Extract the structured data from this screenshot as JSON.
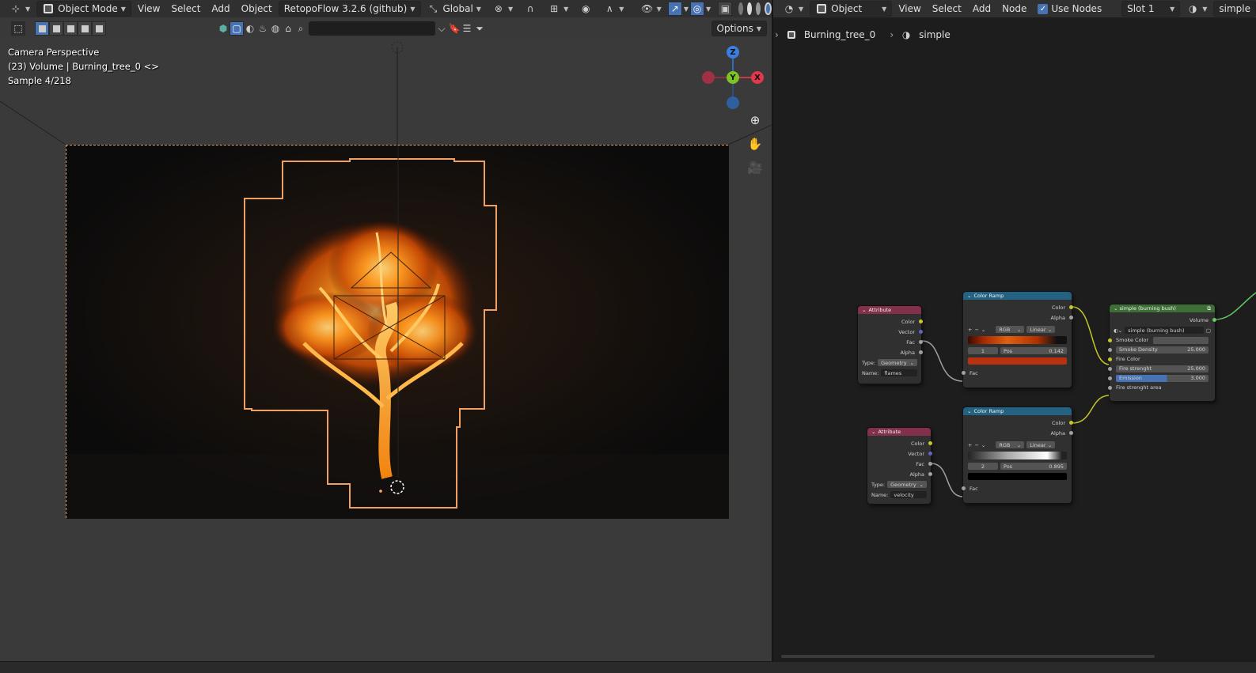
{
  "viewport": {
    "header": {
      "mode": "Object Mode",
      "menus": [
        "View",
        "Select",
        "Add",
        "Object"
      ],
      "addon": "RetopoFlow 3.2.6 (github)",
      "transform_orientation": "Global"
    },
    "header2": {
      "options_label": "Options"
    },
    "overlay": {
      "line1": "Camera Perspective",
      "line2": "(23) Volume | Burning_tree_0 <>",
      "line3": "Sample 4/218"
    },
    "gizmo": {
      "z": "Z",
      "y": "Y",
      "x": "X"
    },
    "colors": {
      "selection_outline": "#f0a060",
      "fire_core": "#ffd060",
      "fire_mid": "#f07a10",
      "fire_edge": "#a03000"
    }
  },
  "node_editor": {
    "header": {
      "editor_type": "Object",
      "menus": [
        "View",
        "Select",
        "Add",
        "Node"
      ],
      "use_nodes_label": "Use Nodes",
      "slot": "Slot 1",
      "material": "simple"
    },
    "breadcrumb": {
      "object": "Burning_tree_0",
      "material": "simple"
    },
    "nodes": {
      "attr1": {
        "title": "Attribute",
        "outputs": [
          "Color",
          "Vector",
          "Fac",
          "Alpha"
        ],
        "type_label": "Type:",
        "type_value": "Geometry",
        "name_label": "Name:",
        "name_value": "flames"
      },
      "attr2": {
        "title": "Attribute",
        "outputs": [
          "Color",
          "Vector",
          "Fac",
          "Alpha"
        ],
        "type_label": "Type:",
        "type_value": "Geometry",
        "name_label": "Name:",
        "name_value": "velocity"
      },
      "ramp1": {
        "title": "Color Ramp",
        "outputs": [
          "Color",
          "Alpha"
        ],
        "color_mode": "RGB",
        "interpolation": "Linear",
        "index": "1",
        "pos_label": "Pos",
        "pos_value": "0.142",
        "input": "Fac",
        "swatch": "#b83212"
      },
      "ramp2": {
        "title": "Color Ramp",
        "outputs": [
          "Color",
          "Alpha"
        ],
        "color_mode": "RGB",
        "interpolation": "Linear",
        "index": "2",
        "pos_label": "Pos",
        "pos_value": "0.895",
        "input": "Fac",
        "swatch": "#000000"
      },
      "shader": {
        "title": "simple (burning bush)",
        "output": "Volume",
        "group": "simple (burning bush)",
        "smoke_color": "Smoke Color",
        "smoke_density_label": "Smoke Density",
        "smoke_density": "25.000",
        "fire_color": "Fire Color",
        "fire_strength_label": "Fire strenght",
        "fire_strength": "25.000",
        "emission_label": "Emission",
        "emission": "3.000",
        "fire_strength_area": "Fire strenght area"
      }
    }
  }
}
